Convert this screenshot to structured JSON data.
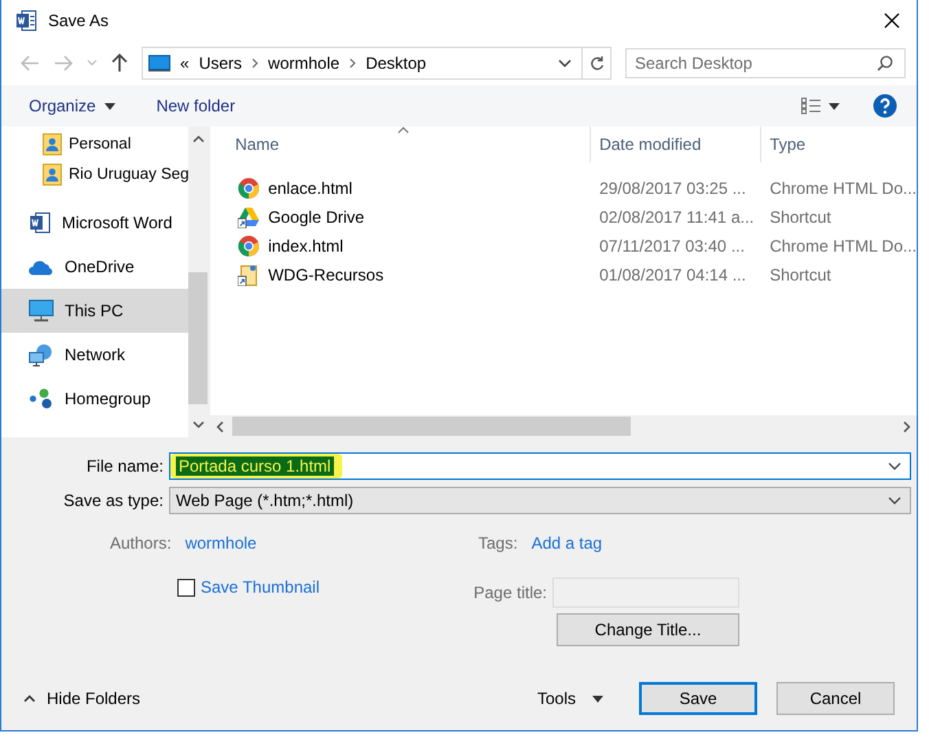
{
  "window": {
    "title": "Save As"
  },
  "address": {
    "prefix": "«",
    "segments": [
      "Users",
      "wormhole",
      "Desktop"
    ]
  },
  "search": {
    "placeholder": "Search Desktop"
  },
  "toolbar": {
    "organize": "Organize",
    "new_folder": "New folder"
  },
  "sidebar": {
    "items": [
      {
        "label": "Personal",
        "kind": "contact",
        "selected": false
      },
      {
        "label": "Rio Uruguay Seg",
        "kind": "contact",
        "selected": false
      },
      {
        "label": "Microsoft Word",
        "kind": "word",
        "selected": false
      },
      {
        "label": "OneDrive",
        "kind": "cloud",
        "selected": false
      },
      {
        "label": "This PC",
        "kind": "pc",
        "selected": true
      },
      {
        "label": "Network",
        "kind": "network",
        "selected": false
      },
      {
        "label": "Homegroup",
        "kind": "homegroup",
        "selected": false
      }
    ]
  },
  "table": {
    "columns": [
      "Name",
      "Date modified",
      "Type"
    ],
    "rows": [
      {
        "name": "enlace.html",
        "date": "29/08/2017 03:25 ...",
        "type": "Chrome HTML Do...",
        "kind": "chrome"
      },
      {
        "name": "Google Drive",
        "date": "02/08/2017 11:41 a...",
        "type": "Shortcut",
        "kind": "drive"
      },
      {
        "name": "index.html",
        "date": "07/11/2017 03:40 ...",
        "type": "Chrome HTML Do...",
        "kind": "chrome"
      },
      {
        "name": "WDG-Recursos",
        "date": "01/08/2017 04:14 ...",
        "type": "Shortcut",
        "kind": "folder-shortcut"
      }
    ]
  },
  "file_name": {
    "label": "File name:",
    "value": "Portada curso 1.html",
    "selected": true
  },
  "save_type": {
    "label": "Save as type:",
    "value": "Web Page (*.htm;*.html)"
  },
  "authors": {
    "label": "Authors:",
    "value": "wormhole"
  },
  "tags": {
    "label": "Tags:",
    "value": "Add a tag"
  },
  "save_thumbnail": {
    "label": "Save Thumbnail",
    "checked": false
  },
  "page_title": {
    "label": "Page title:"
  },
  "change_title": "Change Title...",
  "hide_folders": "Hide Folders",
  "tools": "Tools",
  "buttons": {
    "save": "Save",
    "cancel": "Cancel"
  }
}
